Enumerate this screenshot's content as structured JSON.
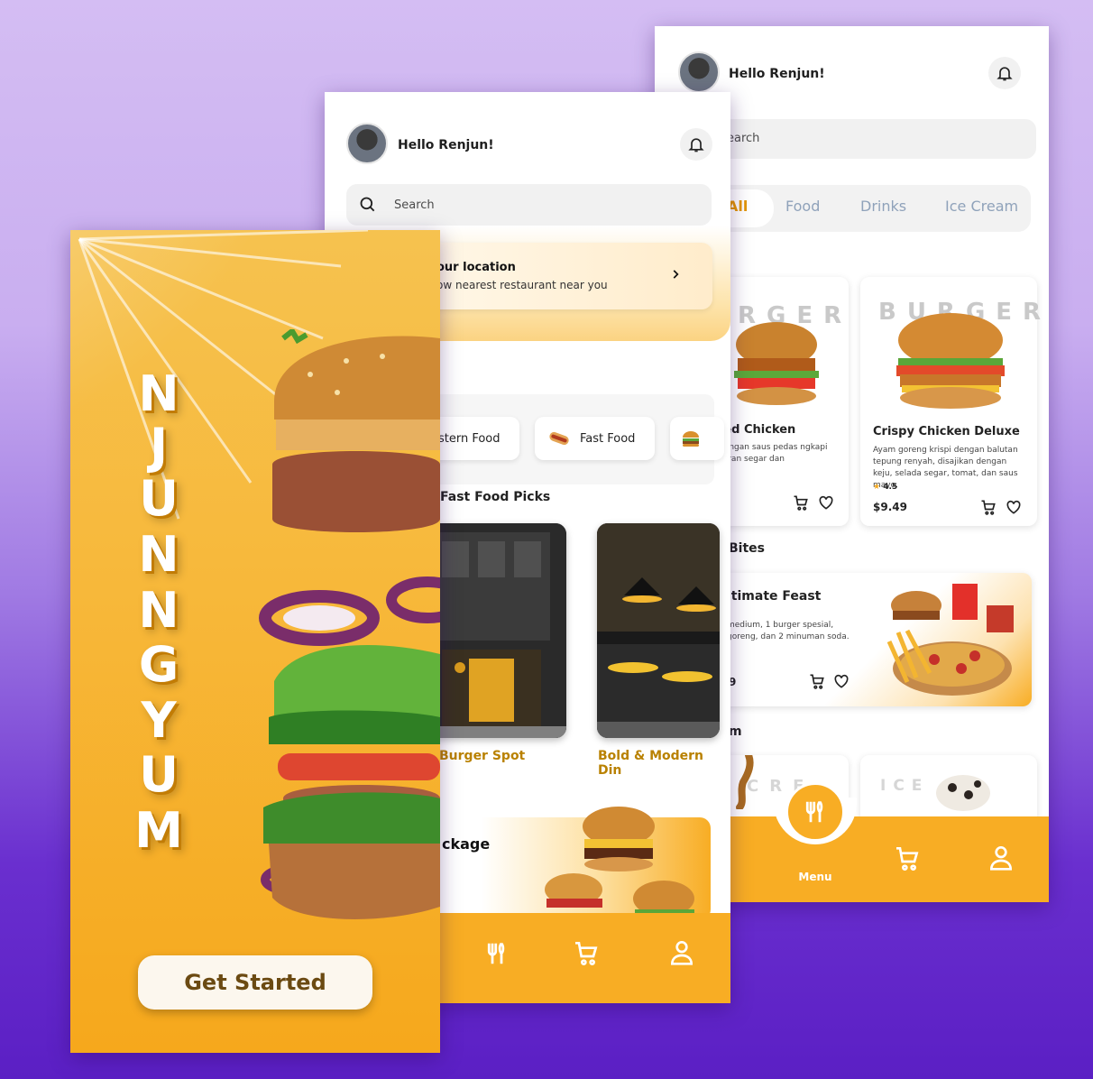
{
  "brand_color": "#f8ad24",
  "menu_screen": {
    "greeting": "Hello Renjun!",
    "search_placeholder": "earch",
    "tabs": [
      "All",
      "Food",
      "Drinks",
      "Ice Cream"
    ],
    "products": [
      {
        "title": "azed Chicken",
        "ghost": "RGER",
        "desc": "pi dengan saus pedas ngkapi sayuran segar dan"
      },
      {
        "title": "Crispy Chicken Deluxe",
        "ghost": "BURGER",
        "desc": "Ayam goreng krispi dengan balutan tepung renyah, disajikan dengan keju, selada segar, tomat, dan saus mayo.",
        "rating": "4.5",
        "price": "$9.49"
      }
    ],
    "section_bites": "Bites",
    "feast": {
      "title": "ltimate Feast",
      "desc": "medium, 1 burger spesial, goreng, dan 2 minuman soda.",
      "price": "9"
    },
    "section_m": "m",
    "ice_ghost_left": "CRE",
    "ice_ghost_right": "ICE   AM",
    "nav_menu_label": "Menu"
  },
  "home_screen": {
    "greeting": "Hello Renjun!",
    "search_placeholder": "Search",
    "location_title": "our location",
    "location_sub": "ow nearest restaurant near you",
    "chips": [
      "astern Food",
      "Fast Food"
    ],
    "section_picks": "Fast Food Picks",
    "restaurants": [
      "Burger Spot",
      "Bold & Modern Din"
    ],
    "package_title": "ckage"
  },
  "splash_screen": {
    "letters": [
      "N",
      "J",
      "U",
      "N",
      "N",
      "G",
      "Y",
      "U",
      "M"
    ],
    "cta": "Get Started"
  }
}
